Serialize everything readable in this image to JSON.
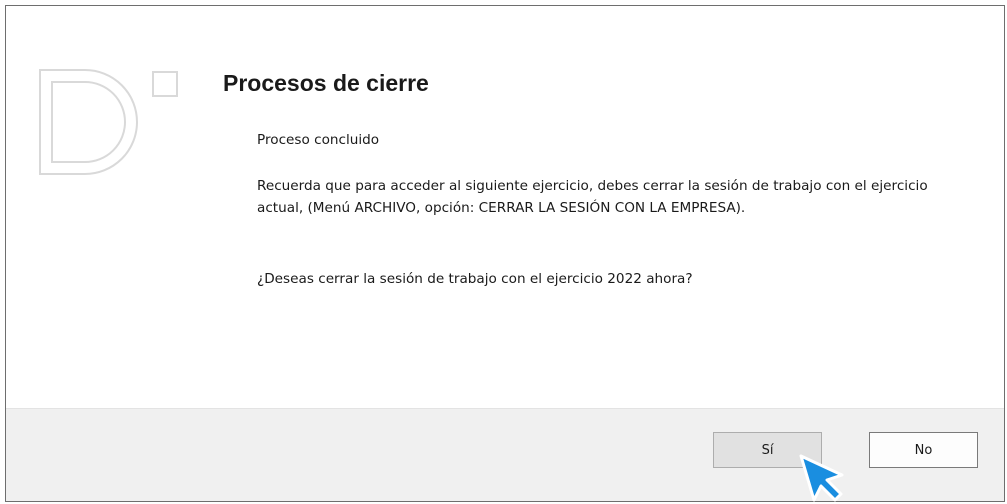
{
  "dialog": {
    "title": "Procesos de cierre",
    "message_status": "Proceso concluido",
    "message_info": "Recuerda que para acceder al siguiente ejercicio, debes cerrar la sesión de trabajo con el ejercicio actual, (Menú ARCHIVO, opción: CERRAR LA SESIÓN CON LA EMPRESA).",
    "message_question": "¿Deseas cerrar la sesión de trabajo con el ejercicio 2022 ahora?"
  },
  "buttons": {
    "yes_label": "Sí",
    "no_label": "No"
  },
  "icons": {
    "logo": "d-logo",
    "pointer": "mouse-pointer-icon"
  },
  "colors": {
    "footer_background": "#f0f0f0",
    "pointer_blue": "#1a8ee0",
    "logo_gray": "#d9d9d9"
  }
}
